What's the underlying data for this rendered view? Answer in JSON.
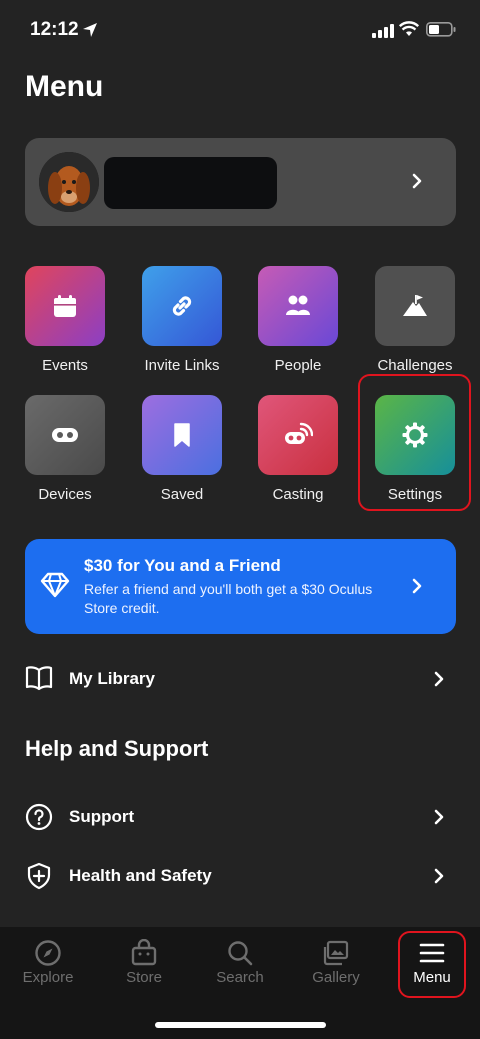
{
  "status_bar": {
    "time": "12:12"
  },
  "page": {
    "title": "Menu"
  },
  "profile": {},
  "grid": [
    {
      "label": "Events",
      "icon": "calendar-icon",
      "gradient": [
        "#e0455c",
        "#8c3fc4"
      ]
    },
    {
      "label": "Invite Links",
      "icon": "link-icon",
      "gradient": [
        "#3fa0ea",
        "#3557d6"
      ]
    },
    {
      "label": "People",
      "icon": "people-icon",
      "gradient": [
        "#c65bb5",
        "#6a48d6"
      ]
    },
    {
      "label": "Challenges",
      "icon": "flag-mountain-icon",
      "gradient": [
        "#505050",
        "#505050"
      ]
    },
    {
      "label": "Devices",
      "icon": "vr-headset-icon",
      "gradient": [
        "#6a6a6a",
        "#4a4a4a"
      ]
    },
    {
      "label": "Saved",
      "icon": "bookmark-icon",
      "gradient": [
        "#9d6ee0",
        "#4b6fe0"
      ]
    },
    {
      "label": "Casting",
      "icon": "casting-icon",
      "gradient": [
        "#e0567a",
        "#c9303f"
      ]
    },
    {
      "label": "Settings",
      "icon": "gear-icon",
      "gradient": [
        "#5bb546",
        "#168f9a"
      ]
    }
  ],
  "promo": {
    "title": "$30 for You and a Friend",
    "description": "Refer a friend and you'll both get a $30 Oculus Store credit.",
    "color": "#1d6ef0"
  },
  "library": {
    "label": "My Library"
  },
  "help": {
    "heading": "Help and Support",
    "items": [
      {
        "label": "Support",
        "icon": "question-circle-icon"
      },
      {
        "label": "Health and Safety",
        "icon": "shield-plus-icon"
      }
    ]
  },
  "bottom_nav": {
    "items": [
      {
        "label": "Explore",
        "icon": "compass-icon",
        "active": false
      },
      {
        "label": "Store",
        "icon": "bag-icon",
        "active": false
      },
      {
        "label": "Search",
        "icon": "search-icon",
        "active": false
      },
      {
        "label": "Gallery",
        "icon": "gallery-icon",
        "active": false
      },
      {
        "label": "Menu",
        "icon": "hamburger-icon",
        "active": true
      }
    ]
  },
  "colors": {
    "background": "#232323",
    "highlight": "#e0141e",
    "card": "#4a4a4a"
  }
}
